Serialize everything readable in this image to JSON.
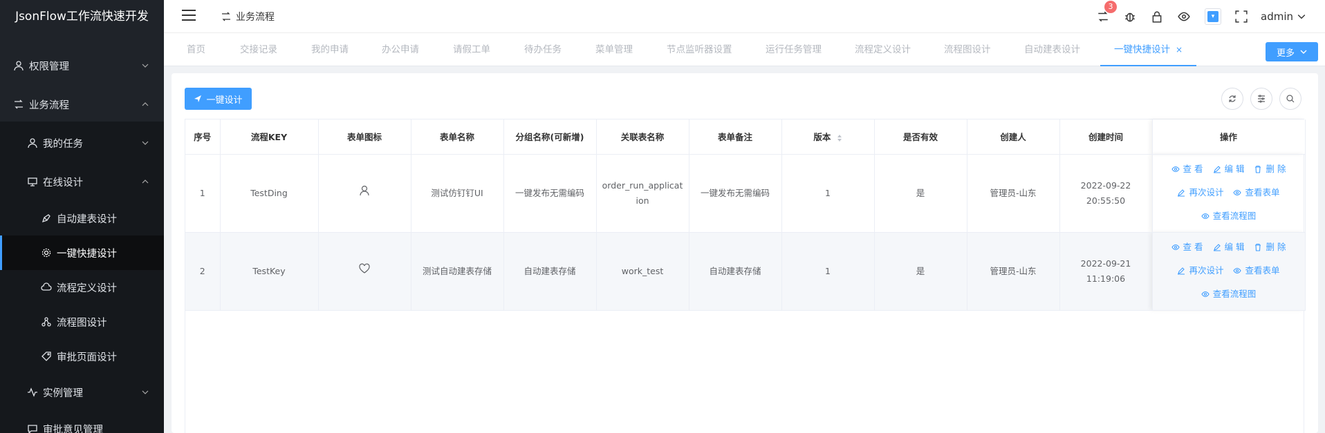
{
  "app": {
    "logo_text": "JsonFlow工作流快速开发"
  },
  "sidebar": {
    "items": [
      {
        "label": "权限管理",
        "icon": "user-icon"
      },
      {
        "label": "业务流程",
        "icon": "flow-icon"
      },
      {
        "label": "我的任务",
        "icon": "user-icon"
      },
      {
        "label": "在线设计",
        "icon": "monitor-icon"
      },
      {
        "label": "自动建表设计",
        "icon": "pen-icon"
      },
      {
        "label": "一键快捷设计",
        "icon": "gear-icon"
      },
      {
        "label": "流程定义设计",
        "icon": "cloud-icon"
      },
      {
        "label": "流程图设计",
        "icon": "nodes-icon"
      },
      {
        "label": "审批页面设计",
        "icon": "tag-icon"
      },
      {
        "label": "实例管理",
        "icon": "pulse-icon"
      },
      {
        "label": "审批意见管理",
        "icon": "chat-icon"
      }
    ]
  },
  "header": {
    "breadcrumb": "业务流程",
    "badge_count": "3",
    "user": "admin",
    "theme_color": "#409eff"
  },
  "tabs": {
    "items": [
      "首页",
      "交接记录",
      "我的申请",
      "办公申请",
      "请假工单",
      "待办任务",
      "菜单管理",
      "节点监听器设置",
      "运行任务管理",
      "流程定义设计",
      "流程图设计",
      "自动建表设计",
      "一键快捷设计"
    ],
    "close_glyph": "×",
    "more_label": "更多"
  },
  "toolbar": {
    "design_label": "一键设计"
  },
  "table": {
    "columns": [
      "序号",
      "流程KEY",
      "表单图标",
      "表单名称",
      "分组名称(可新增)",
      "关联表名称",
      "表单备注",
      "版本",
      "是否有效",
      "创建人",
      "创建时间",
      "操作"
    ],
    "rows": [
      {
        "index": "1",
        "key": "TestDing",
        "icon": "user-icon",
        "form_name": "测试仿钉钉UI",
        "group": "一键发布无需编码",
        "table_name": "order_run_application",
        "remark": "一键发布无需编码",
        "version": "1",
        "valid": "是",
        "creator": "管理员-山东",
        "created": "2022-09-22 20:55:50"
      },
      {
        "index": "2",
        "key": "TestKey",
        "icon": "heart-icon",
        "form_name": "测试自动建表存储",
        "group": "自动建表存储",
        "table_name": "work_test",
        "remark": "自动建表存储",
        "version": "1",
        "valid": "是",
        "creator": "管理员-山东",
        "created": "2022-09-21 11:19:06"
      }
    ],
    "ops": {
      "view": "查 看",
      "edit": "编 辑",
      "delete": "删 除",
      "redesign": "再次设计",
      "view_form": "查看表单",
      "view_flow": "查看流程图"
    }
  },
  "colors": {
    "primary": "#409eff",
    "sidebar_bg": "#1f2329",
    "danger": "#f56c6c"
  }
}
